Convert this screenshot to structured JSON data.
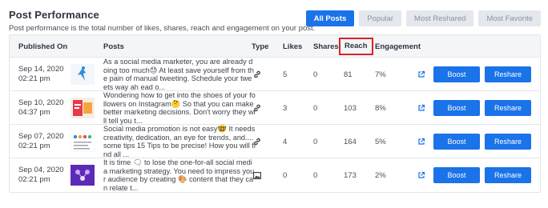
{
  "header": {
    "title": "Post Performance",
    "subtitle": "Post performance is the total number of likes, shares, reach and engagement on your post."
  },
  "filters": [
    {
      "label": "All Posts",
      "active": true
    },
    {
      "label": "Popular",
      "active": false
    },
    {
      "label": "Most Reshared",
      "active": false
    },
    {
      "label": "Most Favorite",
      "active": false
    }
  ],
  "table": {
    "columns": {
      "published": "Published On",
      "posts": "Posts",
      "type": "Type",
      "likes": "Likes",
      "shares": "Shares",
      "reach": "Reach",
      "engagement": "Engagement"
    },
    "rows": [
      {
        "date": "Sep 14, 2020",
        "time": "02:21 pm",
        "text": "As a social media marketer, you are already doing too much😓 At least save yourself from the pain of manual tweeting. Schedule your tweets way ah ead o...",
        "type_icon": "link-icon",
        "likes": "5",
        "shares": "0",
        "reach": "81",
        "engagement": "7%",
        "boost": "Boost",
        "reshare": "Reshare"
      },
      {
        "date": "Sep 10, 2020",
        "time": "04:37 pm",
        "text": "Wondering how to get into the shoes of your followers on Instagram🤔 So that you can make better marketing decisions. Don't worry they will tell you t...",
        "type_icon": "link-icon",
        "likes": "3",
        "shares": "0",
        "reach": "103",
        "engagement": "8%",
        "boost": "Boost",
        "reshare": "Reshare"
      },
      {
        "date": "Sep 07, 2020",
        "time": "02:21 pm",
        "text": "Social media promotion is not easy🤓 It needs creativity, dedication, an eye for trends, and....some tips 15 Tips to be precise! How you will find all ...",
        "type_icon": "link-icon",
        "likes": "4",
        "shares": "0",
        "reach": "164",
        "engagement": "5%",
        "boost": "Boost",
        "reshare": "Reshare"
      },
      {
        "date": "Sep 04, 2020",
        "time": "02:21 pm",
        "text": "It is time 🗨 to lose the one-for-all social media marketing strategy. You need to impress your audience by creating 🎨 content that they can relate t...",
        "type_icon": "image-icon",
        "likes": "0",
        "shares": "0",
        "reach": "173",
        "engagement": "2%",
        "boost": "Boost",
        "reshare": "Reshare"
      }
    ]
  },
  "colors": {
    "accent": "#1a73e8",
    "highlight_border": "#d9222a"
  }
}
